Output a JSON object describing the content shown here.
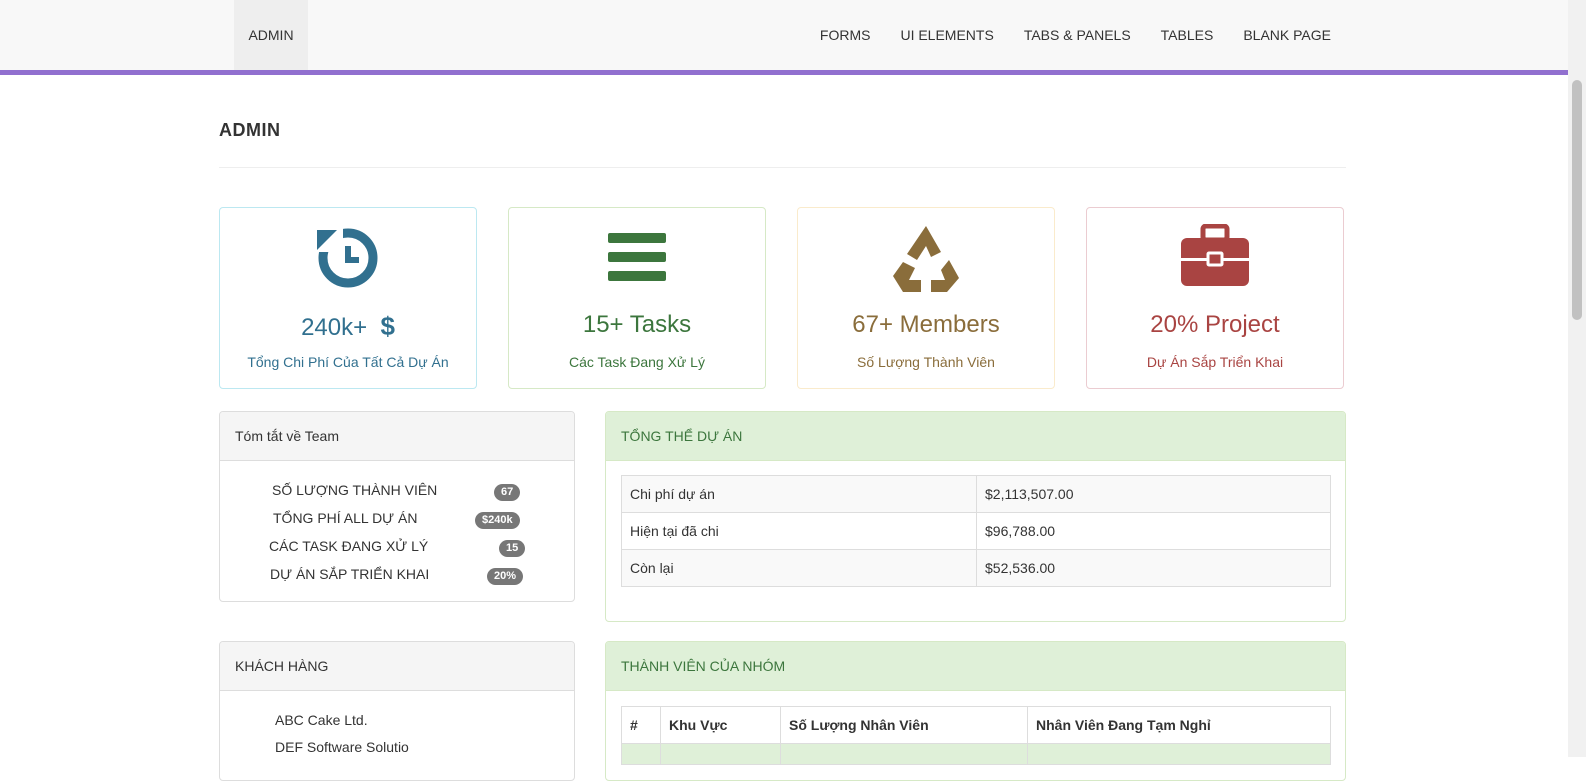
{
  "nav": {
    "brand": "ADMIN",
    "links": [
      "FORMS",
      "UI ELEMENTS",
      "TABS & PANELS",
      "TABLES",
      "BLANK PAGE"
    ]
  },
  "page_title": "ADMIN",
  "stats": [
    {
      "value": "240k+",
      "extra": "$",
      "label": "Tổng Chi Phí Của Tất Cả Dự Án",
      "icon": "history-icon",
      "color": "#31708f"
    },
    {
      "value": "15+ Tasks",
      "label": "Các Task Đang Xử Lý",
      "icon": "bars-icon",
      "color": "#3c763d"
    },
    {
      "value": "67+ Members",
      "label": "Số Lượng Thành Viên",
      "icon": "recycle-icon",
      "color": "#8a6d3b"
    },
    {
      "value": "20% Project",
      "label": "Dự Án Sắp Triển Khai",
      "icon": "briefcase-icon",
      "color": "#a94442"
    }
  ],
  "team": {
    "title": "Tóm tắt về Team",
    "items": [
      {
        "label": "SỐ LƯỢNG THÀNH VIÊN",
        "badge": "67"
      },
      {
        "label": "TỔNG PHÍ ALL DỰ ÁN",
        "badge": "$240k"
      },
      {
        "label": "CÁC TASK ĐANG XỬ LÝ",
        "badge": "15"
      },
      {
        "label": "DỰ ÁN SẮP TRIỂN KHAI",
        "badge": "20%"
      }
    ]
  },
  "overview": {
    "title": "TỔNG THỂ DỰ ÁN",
    "rows": [
      {
        "label": "Chi phí dự án",
        "value": "$2,113,507.00"
      },
      {
        "label": "Hiện tại đã chi",
        "value": "$96,788.00"
      },
      {
        "label": "Còn lại",
        "value": "$52,536.00"
      }
    ]
  },
  "customers": {
    "title": "KHÁCH HÀNG",
    "items": [
      "ABC Cake Ltd.",
      "DEF Software Solutio"
    ]
  },
  "members": {
    "title": "THÀNH VIÊN CỦA NHÓM",
    "headers": [
      "#",
      "Khu Vực",
      "Số Lượng Nhân Viên",
      "Nhân Viên Đang Tạm Nghỉ"
    ]
  }
}
